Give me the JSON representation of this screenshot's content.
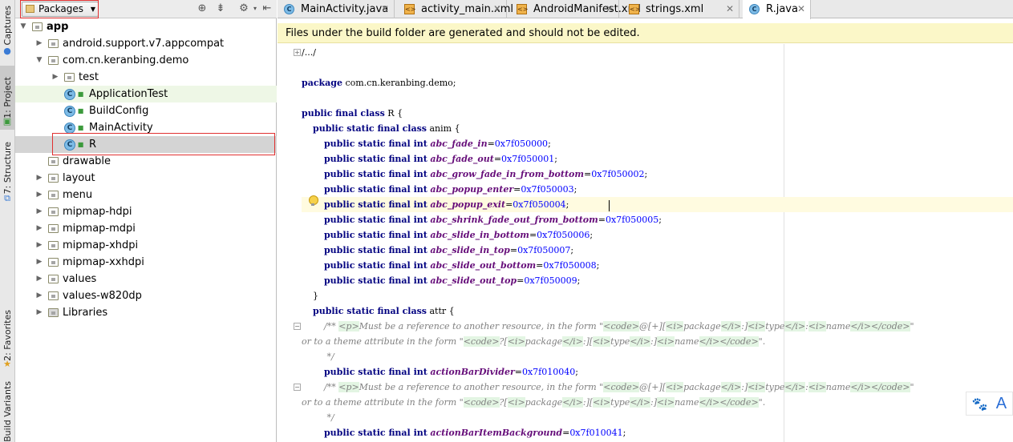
{
  "left_strip": {
    "tabs": [
      "Captures",
      "1: Project",
      "7: Structure",
      "2: Favorites",
      "Build Variants"
    ]
  },
  "project_panel": {
    "view_selector": "Packages",
    "header_icons": [
      "target-icon",
      "collapse-icon",
      "gear-icon",
      "hide-icon"
    ],
    "tree": [
      {
        "label": "app",
        "icon": "module-folder",
        "expanded": true
      },
      {
        "label": "android.support.v7.appcompat",
        "icon": "package-folder",
        "expanded": false
      },
      {
        "label": "com.cn.keranbing.demo",
        "icon": "package-folder",
        "expanded": true
      },
      {
        "label": "test",
        "icon": "package-folder",
        "expanded": false
      },
      {
        "label": "ApplicationTest",
        "icon": "test-class"
      },
      {
        "label": "BuildConfig",
        "icon": "class"
      },
      {
        "label": "MainActivity",
        "icon": "class"
      },
      {
        "label": "R",
        "icon": "class",
        "selected": true
      },
      {
        "label": "drawable",
        "icon": "resource-folder"
      },
      {
        "label": "layout",
        "icon": "resource-folder",
        "expanded": false
      },
      {
        "label": "menu",
        "icon": "resource-folder",
        "expanded": false
      },
      {
        "label": "mipmap-hdpi",
        "icon": "resource-folder",
        "expanded": false
      },
      {
        "label": "mipmap-mdpi",
        "icon": "resource-folder",
        "expanded": false
      },
      {
        "label": "mipmap-xhdpi",
        "icon": "resource-folder",
        "expanded": false
      },
      {
        "label": "mipmap-xxhdpi",
        "icon": "resource-folder",
        "expanded": false
      },
      {
        "label": "values",
        "icon": "resource-folder",
        "expanded": false
      },
      {
        "label": "values-w820dp",
        "icon": "resource-folder",
        "expanded": false
      },
      {
        "label": "Libraries",
        "icon": "libraries-icon",
        "expanded": false
      }
    ]
  },
  "editor_tabs": [
    {
      "label": "MainActivity.java",
      "type": "java"
    },
    {
      "label": "activity_main.xml",
      "type": "xml"
    },
    {
      "label": "AndroidManifest.xml",
      "type": "xml"
    },
    {
      "label": "strings.xml",
      "type": "xml"
    },
    {
      "label": "R.java",
      "type": "java",
      "active": true
    }
  ],
  "banner": "Files under the build folder are generated and should not be edited.",
  "code": {
    "fold_header": "/.../",
    "package_line": "com.cn.keranbing.demo;",
    "class_name": "R",
    "anim_class": "anim",
    "anim_fields": [
      {
        "name": "abc_fade_in",
        "value": "0x7f050000"
      },
      {
        "name": "abc_fade_out",
        "value": "0x7f050001"
      },
      {
        "name": "abc_grow_fade_in_from_bottom",
        "value": "0x7f050002"
      },
      {
        "name": "abc_popup_enter",
        "value": "0x7f050003"
      },
      {
        "name": "abc_popup_exit",
        "value": "0x7f050004"
      },
      {
        "name": "abc_shrink_fade_out_from_bottom",
        "value": "0x7f050005"
      },
      {
        "name": "abc_slide_in_bottom",
        "value": "0x7f050006"
      },
      {
        "name": "abc_slide_in_top",
        "value": "0x7f050007"
      },
      {
        "name": "abc_slide_out_bottom",
        "value": "0x7f050008"
      },
      {
        "name": "abc_slide_out_top",
        "value": "0x7f050009"
      }
    ],
    "attr_class": "attr",
    "attr_doc_prefix": "Must be a reference to another resource, in the form ",
    "attr_doc_line2": "or to a theme attribute in the form ",
    "attr_fields": [
      {
        "name": "actionBarDivider",
        "value": "0x7f010040"
      },
      {
        "name": "actionBarItemBackground",
        "value": "0x7f010041"
      }
    ]
  },
  "colors": {
    "banner_bg": "#fbf7c8",
    "keyword": "#000080",
    "field": "#660e7a",
    "number": "#0000ff",
    "comment": "#808080",
    "highlight_box": "#e03030"
  }
}
